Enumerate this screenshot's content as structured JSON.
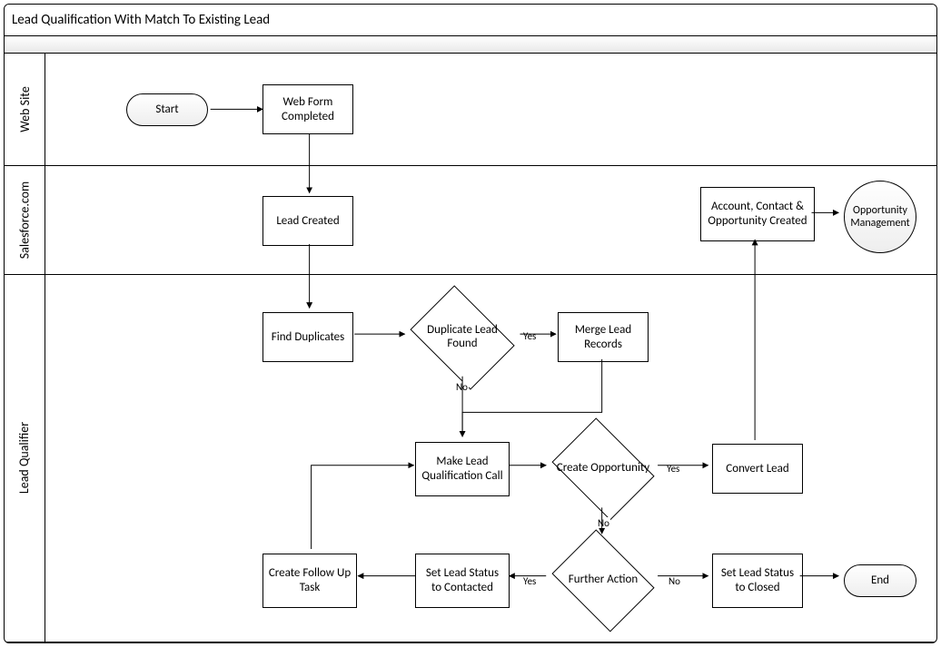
{
  "title": "Lead Qualification With Match To Existing Lead",
  "lanes": {
    "web": "Web Site",
    "sfdc": "Salesforce.com",
    "lq": "Lead Qualifier"
  },
  "nodes": {
    "start": "Start",
    "webform": "Web Form Completed",
    "leadcreated": "Lead Created",
    "acctcontact": "Account, Contact & Opportunity Created",
    "oppmgmt": "Opportunity Management",
    "finddup": "Find Duplicates",
    "dupfound": "Duplicate Lead Found",
    "merge": "Merge Lead Records",
    "makecall": "Make Lead Qualification Call",
    "createopp": "Create Opportunity",
    "convert": "Convert Lead",
    "further": "Further Action",
    "setcontacted": "Set Lead Status to Contacted",
    "followup": "Create Follow Up Task",
    "setclosed": "Set Lead Status to Closed",
    "end": "End"
  },
  "edgeLabels": {
    "yes": "Yes",
    "no": "No"
  }
}
